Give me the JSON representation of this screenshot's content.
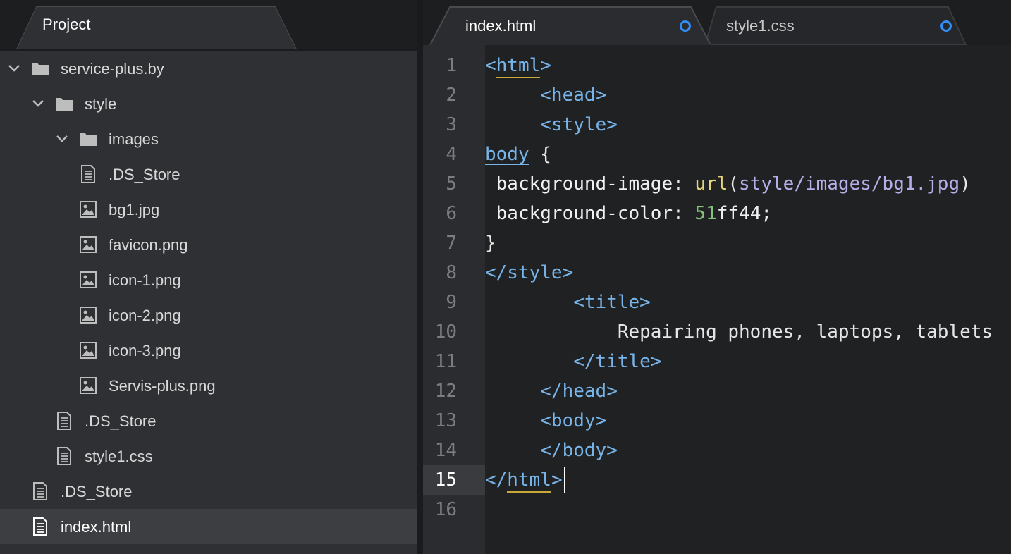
{
  "tree_panel": {
    "tab_label": "Project",
    "items": [
      {
        "label": "service-plus.by",
        "kind": "folder",
        "depth": 0,
        "expanded": true,
        "icon": "folder-icon"
      },
      {
        "label": "style",
        "kind": "folder",
        "depth": 1,
        "expanded": true,
        "icon": "folder-icon"
      },
      {
        "label": "images",
        "kind": "folder",
        "depth": 2,
        "expanded": true,
        "icon": "folder-icon"
      },
      {
        "label": ".DS_Store",
        "kind": "file",
        "depth": 3,
        "icon": "file-icon"
      },
      {
        "label": "bg1.jpg",
        "kind": "image",
        "depth": 3,
        "icon": "image-file-icon"
      },
      {
        "label": "favicon.png",
        "kind": "image",
        "depth": 3,
        "icon": "image-file-icon"
      },
      {
        "label": "icon-1.png",
        "kind": "image",
        "depth": 3,
        "icon": "image-file-icon"
      },
      {
        "label": "icon-2.png",
        "kind": "image",
        "depth": 3,
        "icon": "image-file-icon"
      },
      {
        "label": "icon-3.png",
        "kind": "image",
        "depth": 3,
        "icon": "image-file-icon"
      },
      {
        "label": "Servis-plus.png",
        "kind": "image",
        "depth": 3,
        "icon": "image-file-icon"
      },
      {
        "label": ".DS_Store",
        "kind": "file",
        "depth": 2,
        "icon": "file-icon"
      },
      {
        "label": "style1.css",
        "kind": "file",
        "depth": 2,
        "icon": "file-icon"
      },
      {
        "label": ".DS_Store",
        "kind": "file",
        "depth": 1,
        "icon": "file-icon"
      },
      {
        "label": "index.html",
        "kind": "file",
        "depth": 1,
        "icon": "file-icon",
        "selected": true
      }
    ]
  },
  "editor": {
    "tabs": [
      {
        "label": "index.html",
        "active": true,
        "modified": true
      },
      {
        "label": "style1.css",
        "active": false,
        "modified": true
      }
    ],
    "line_numbers": [
      "1",
      "2",
      "3",
      "4",
      "5",
      "6",
      "7",
      "8",
      "9",
      "10",
      "11",
      "12",
      "13",
      "14",
      "15",
      "16"
    ],
    "active_line": "15",
    "lines": [
      [
        {
          "t": "<html>",
          "c": "tag"
        }
      ],
      [
        {
          "t": "     ",
          "c": "txt"
        },
        {
          "t": "<head>",
          "c": "tag"
        }
      ],
      [
        {
          "t": "     ",
          "c": "txt"
        },
        {
          "t": "<style>",
          "c": "tag"
        }
      ],
      [
        {
          "t": "body",
          "c": "sel"
        },
        {
          "t": " {",
          "c": "txt"
        }
      ],
      [
        {
          "t": " background-image: ",
          "c": "prop"
        },
        {
          "t": "url",
          "c": "fn"
        },
        {
          "t": "(",
          "c": "txt"
        },
        {
          "t": "style/images/bg1.jpg",
          "c": "str"
        },
        {
          "t": ")",
          "c": "txt"
        }
      ],
      [
        {
          "t": " background-color: ",
          "c": "prop"
        },
        {
          "t": "51",
          "c": "num"
        },
        {
          "t": "ff44;",
          "c": "prop"
        }
      ],
      [
        {
          "t": "}",
          "c": "txt"
        }
      ],
      [
        {
          "t": "</style>",
          "c": "tag"
        }
      ],
      [
        {
          "t": "        ",
          "c": "txt"
        },
        {
          "t": "<title>",
          "c": "tag"
        }
      ],
      [
        {
          "t": "            Repairing phones, laptops, tablets",
          "c": "txt"
        }
      ],
      [
        {
          "t": "        ",
          "c": "txt"
        },
        {
          "t": "</title>",
          "c": "tag"
        }
      ],
      [
        {
          "t": "     ",
          "c": "txt"
        },
        {
          "t": "</head>",
          "c": "tag"
        }
      ],
      [
        {
          "t": "     ",
          "c": "txt"
        },
        {
          "t": "<body>",
          "c": "tag"
        }
      ],
      [
        {
          "t": "     ",
          "c": "txt"
        },
        {
          "t": "</body>",
          "c": "tag"
        }
      ],
      [
        {
          "t": "</html>",
          "c": "tag"
        }
      ],
      []
    ]
  },
  "colors": {
    "accent": "#2f8ff7",
    "tag": "#78b4e8",
    "function": "#e8d579",
    "string": "#b6aee8",
    "number": "#86c37a",
    "bracket_match": "#c8a93a"
  }
}
